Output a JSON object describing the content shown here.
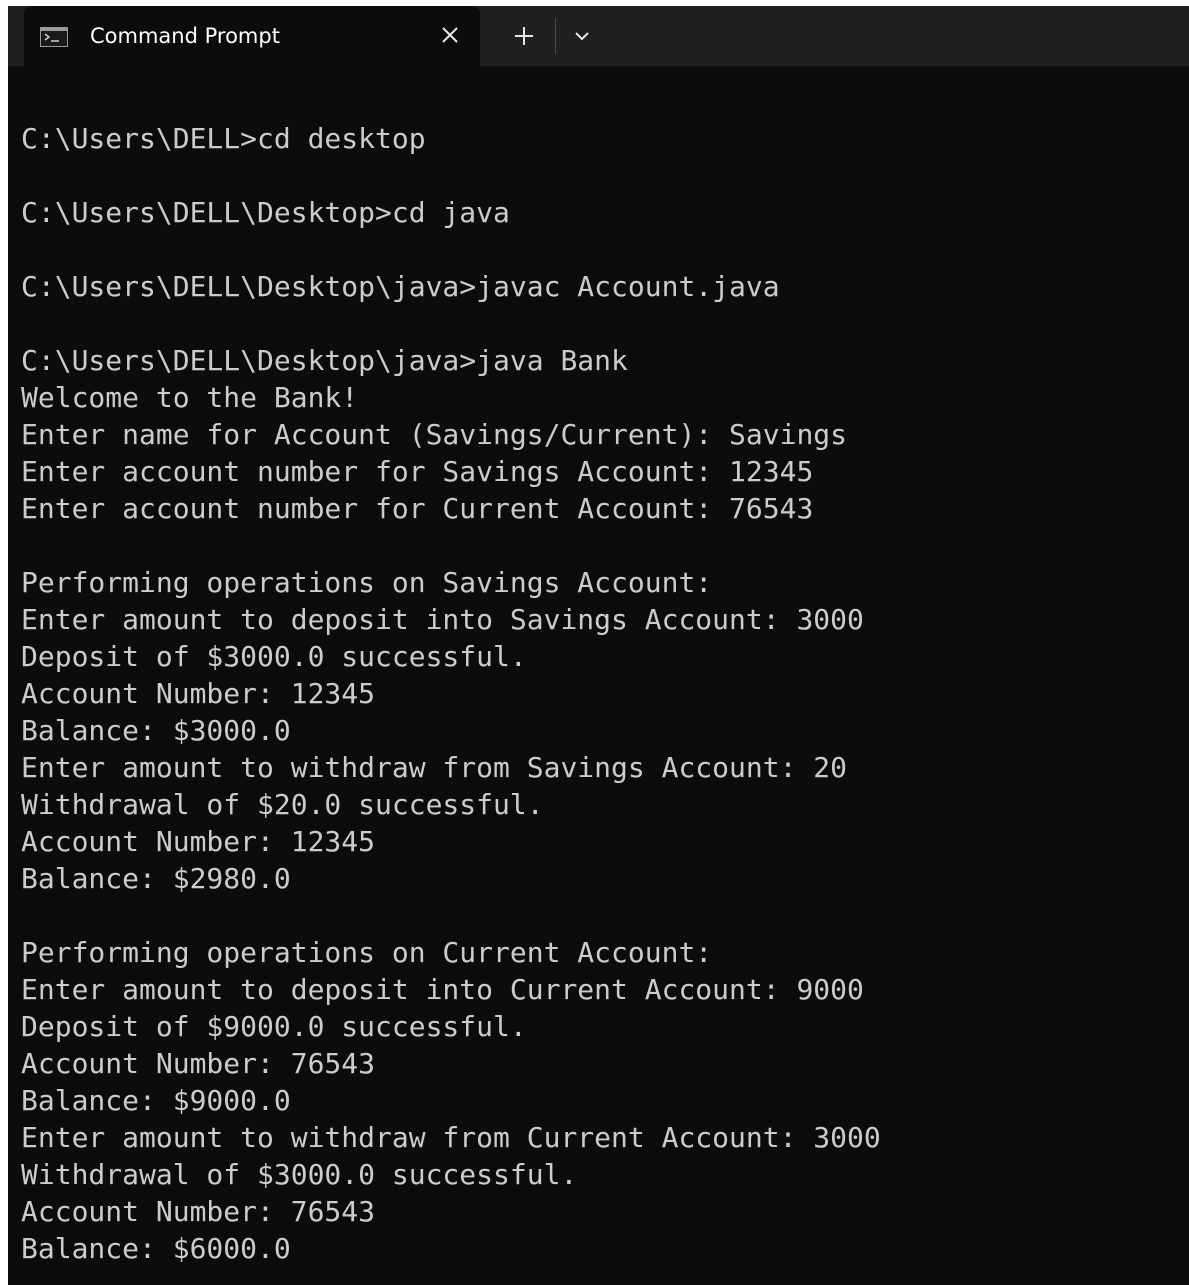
{
  "tab": {
    "title": "Command Prompt",
    "icon": "cmd-icon"
  },
  "tabbar": {
    "close_icon": "close-icon",
    "new_tab_icon": "plus-icon",
    "dropdown_icon": "chevron-down-icon"
  },
  "console": {
    "lines": [
      "",
      "C:\\Users\\DELL>cd desktop",
      "",
      "C:\\Users\\DELL\\Desktop>cd java",
      "",
      "C:\\Users\\DELL\\Desktop\\java>javac Account.java",
      "",
      "C:\\Users\\DELL\\Desktop\\java>java Bank",
      "Welcome to the Bank!",
      "Enter name for Account (Savings/Current): Savings",
      "Enter account number for Savings Account: 12345",
      "Enter account number for Current Account: 76543",
      "",
      "Performing operations on Savings Account:",
      "Enter amount to deposit into Savings Account: 3000",
      "Deposit of $3000.0 successful.",
      "Account Number: 12345",
      "Balance: $3000.0",
      "Enter amount to withdraw from Savings Account: 20",
      "Withdrawal of $20.0 successful.",
      "Account Number: 12345",
      "Balance: $2980.0",
      "",
      "Performing operations on Current Account:",
      "Enter amount to deposit into Current Account: 9000",
      "Deposit of $9000.0 successful.",
      "Account Number: 76543",
      "Balance: $9000.0",
      "Enter amount to withdraw from Current Account: 3000",
      "Withdrawal of $3000.0 successful.",
      "Account Number: 76543",
      "Balance: $6000.0"
    ]
  },
  "colors": {
    "console_background": "#0c0c0c",
    "console_text": "#cccccc",
    "tabbar_background": "#202020",
    "tab_text": "#ffffff"
  }
}
